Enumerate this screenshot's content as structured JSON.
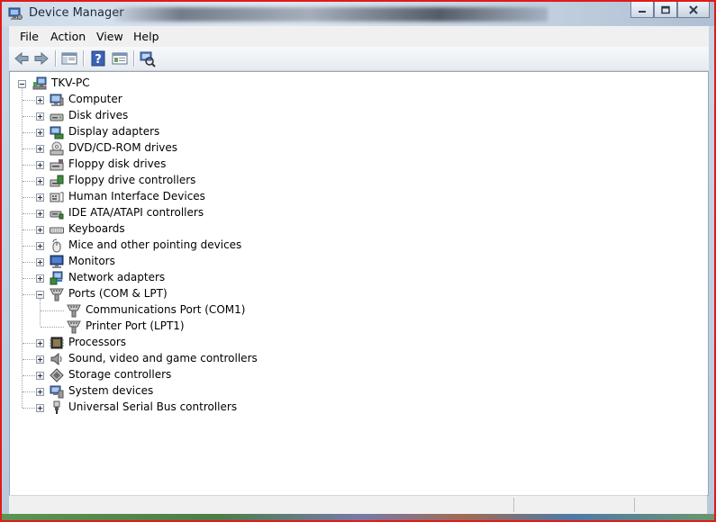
{
  "window": {
    "title": "Device Manager",
    "icon": "device-manager-icon",
    "border_color": "#e01b1b",
    "controls": [
      "minimize-icon",
      "maximize-icon",
      "close-icon"
    ]
  },
  "menu": {
    "file": "File",
    "action": "Action",
    "view": "View",
    "help": "Help"
  },
  "toolbar": {
    "buttons": [
      "back-arrow-icon",
      "forward-arrow-icon",
      "show-hide-console-tree-icon",
      "help-icon",
      "properties-icon",
      "scan-hardware-icon"
    ]
  },
  "tree": {
    "root": {
      "label": "TKV-PC",
      "icon": "computer-network-icon",
      "expanded": true
    },
    "categories": [
      {
        "label": "Computer",
        "icon": "computer-icon",
        "expanded": false
      },
      {
        "label": "Disk drives",
        "icon": "disk-drive-icon",
        "expanded": false
      },
      {
        "label": "Display adapters",
        "icon": "display-adapter-icon",
        "expanded": false
      },
      {
        "label": "DVD/CD-ROM drives",
        "icon": "dvd-drive-icon",
        "expanded": false
      },
      {
        "label": "Floppy disk drives",
        "icon": "floppy-drive-icon",
        "expanded": false
      },
      {
        "label": "Floppy drive controllers",
        "icon": "floppy-controller-icon",
        "expanded": false
      },
      {
        "label": "Human Interface Devices",
        "icon": "hid-icon",
        "expanded": false
      },
      {
        "label": "IDE ATA/ATAPI controllers",
        "icon": "ide-controller-icon",
        "expanded": false
      },
      {
        "label": "Keyboards",
        "icon": "keyboard-icon",
        "expanded": false
      },
      {
        "label": "Mice and other pointing devices",
        "icon": "mouse-icon",
        "expanded": false
      },
      {
        "label": "Monitors",
        "icon": "monitor-icon",
        "expanded": false
      },
      {
        "label": "Network adapters",
        "icon": "network-adapter-icon",
        "expanded": false
      },
      {
        "label": "Ports (COM & LPT)",
        "icon": "port-icon",
        "expanded": true
      },
      {
        "label": "Processors",
        "icon": "processor-icon",
        "expanded": false
      },
      {
        "label": "Sound, video and game controllers",
        "icon": "speaker-icon",
        "expanded": false
      },
      {
        "label": "Storage controllers",
        "icon": "storage-controller-icon",
        "expanded": false
      },
      {
        "label": "System devices",
        "icon": "system-device-icon",
        "expanded": false
      },
      {
        "label": "Universal Serial Bus controllers",
        "icon": "usb-icon",
        "expanded": false
      }
    ],
    "ports_children": [
      {
        "label": "Communications Port (COM1)",
        "icon": "port-icon"
      },
      {
        "label": "Printer Port (LPT1)",
        "icon": "port-icon"
      }
    ]
  }
}
